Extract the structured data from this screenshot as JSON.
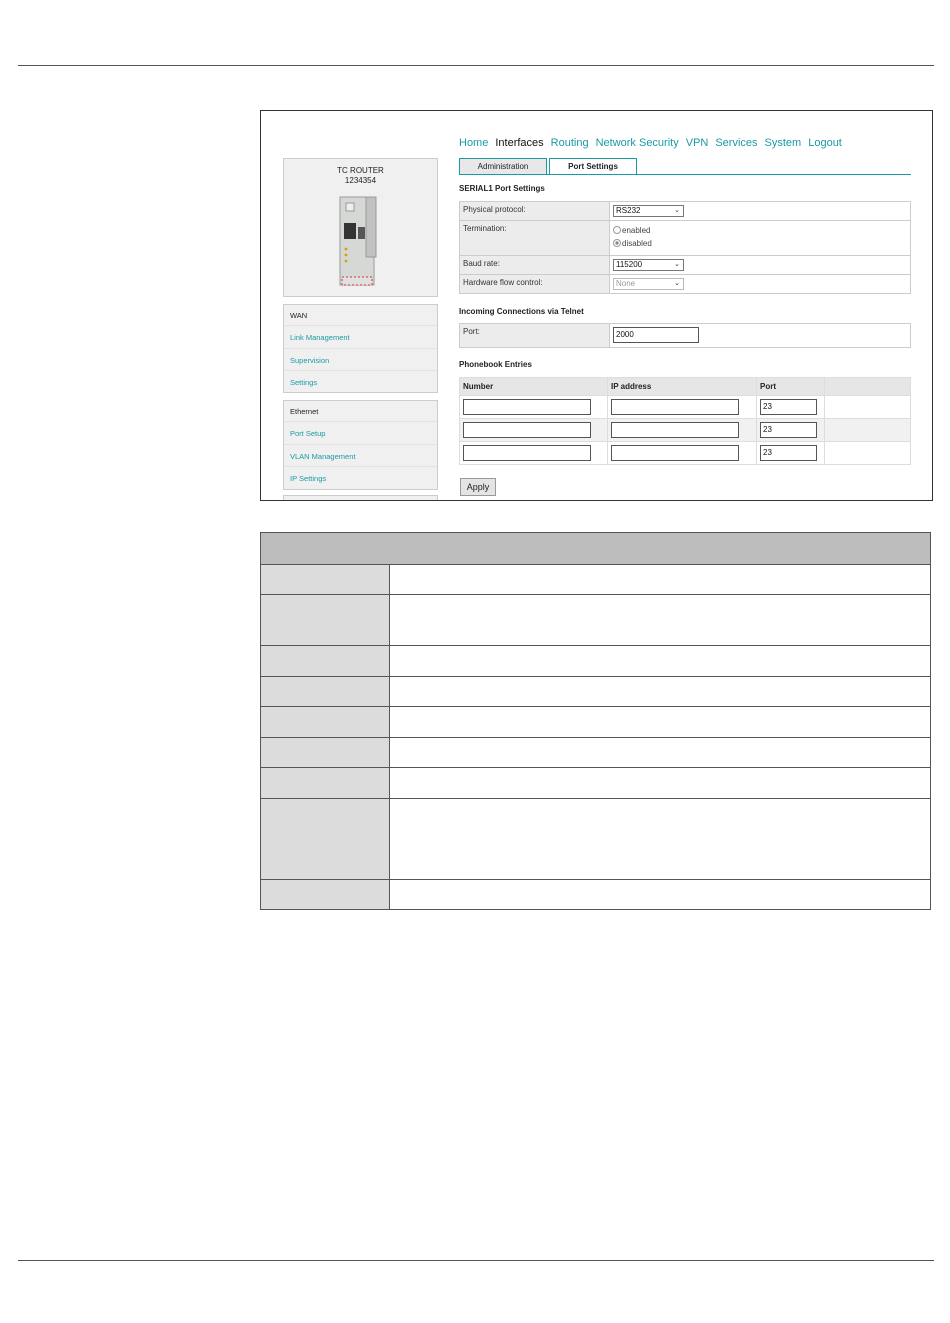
{
  "nav": {
    "items": [
      "Home",
      "Interfaces",
      "Routing",
      "Network Security",
      "VPN",
      "Services",
      "System",
      "Logout"
    ],
    "active": "Interfaces"
  },
  "tabs": [
    "Administration",
    "Port Settings"
  ],
  "device": {
    "name": "TC ROUTER",
    "serial": "1234354"
  },
  "sidebar": {
    "wan": {
      "title": "WAN",
      "items": [
        "Link Management",
        "Supervision",
        "Settings"
      ]
    },
    "ethernet": {
      "title": "Ethernet",
      "items": [
        "Port Setup",
        "VLAN Management",
        "IP Settings"
      ]
    }
  },
  "serial": {
    "title": "SERIAL1 Port Settings",
    "physical_protocol_label": "Physical protocol:",
    "physical_protocol_value": "RS232",
    "termination_label": "Termination:",
    "termination_options": [
      "enabled",
      "disabled"
    ],
    "termination_selected": "disabled",
    "baud_label": "Baud rate:",
    "baud_value": "115200",
    "flow_label": "Hardware flow control:",
    "flow_value": "None"
  },
  "telnet": {
    "title": "Incoming Connections via Telnet",
    "port_label": "Port:",
    "port_value": "2000"
  },
  "phonebook": {
    "title": "Phonebook Entries",
    "headers": [
      "Number",
      "IP address",
      "Port"
    ],
    "rows": [
      {
        "number": "",
        "ip": "",
        "port": "23"
      },
      {
        "number": "",
        "ip": "",
        "port": "23"
      },
      {
        "number": "",
        "ip": "",
        "port": "23"
      }
    ]
  },
  "apply_label": "Apply",
  "colors": {
    "link": "#1a9aa5",
    "table_header": "#bdbdbd",
    "param_label_cell": "#dcdcdc"
  }
}
